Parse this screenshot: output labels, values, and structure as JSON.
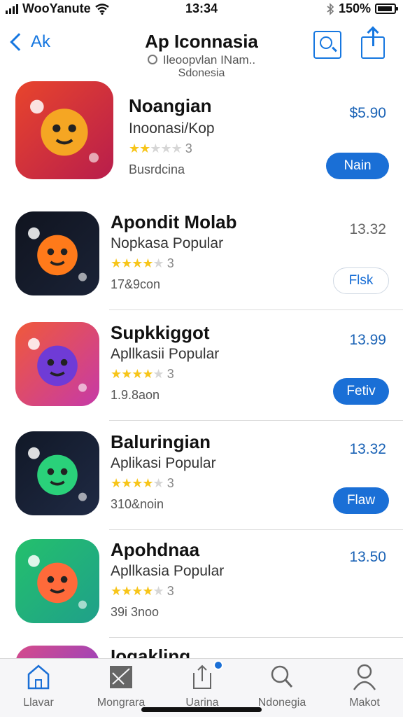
{
  "status_bar": {
    "carrier": "WooYanute",
    "time": "13:34",
    "battery": "150%"
  },
  "header": {
    "back_label": "Ak",
    "title": "Ap Iconnasia",
    "subtitle": "Ileoopvlan INam..",
    "subtitle2": "Sdonesia",
    "search_icon": "search-icon",
    "share_icon": "share-icon"
  },
  "apps": [
    {
      "name": "Noangian",
      "category": "Inoonasi/Kop",
      "rating_count": "3",
      "stars": 2,
      "downloads": "Busrdcina",
      "price": "$5.90",
      "button_label": "Nain",
      "button_style": "filled",
      "colors": [
        "#e8452c",
        "#b81d4c",
        "#f5a623"
      ]
    },
    {
      "name": "Apondit Molab",
      "category": "Nopkasa Popular",
      "rating_count": "3",
      "stars": 4,
      "downloads": "17&9con",
      "price": "13.32",
      "button_label": "Flsk",
      "button_style": "outline",
      "colors": [
        "#10141f",
        "#1a2236",
        "#ff7a1a"
      ]
    },
    {
      "name": "Supkkiggot",
      "category": "Apllkasii Popular",
      "rating_count": "3",
      "stars": 4,
      "downloads": "1.9.8aon",
      "price": "13.99",
      "button_label": "Fetiv",
      "button_style": "filled",
      "colors": [
        "#f0593a",
        "#c63aa8",
        "#6f3bd6"
      ]
    },
    {
      "name": "Baluringian",
      "category": "Aplikasi Popular",
      "rating_count": "3",
      "stars": 4,
      "downloads": "310&noin",
      "price": "13.32",
      "button_label": "Flaw",
      "button_style": "filled",
      "colors": [
        "#111827",
        "#1f2a44",
        "#2ad17a"
      ]
    },
    {
      "name": "Apohdnaa",
      "category": "Apllkasia Popular",
      "rating_count": "3",
      "stars": 4,
      "downloads": "39i 3noo",
      "price": "13.50",
      "button_label": "",
      "button_style": "none",
      "colors": [
        "#24c06c",
        "#1fa08a",
        "#ff6a3a"
      ]
    },
    {
      "name": "Iogakling",
      "category": "",
      "rating_count": "",
      "stars": 0,
      "downloads": "",
      "price": "",
      "button_label": "",
      "button_style": "none",
      "colors": [
        "#d64b8a",
        "#7b3fd6",
        "#2a7be0"
      ]
    }
  ],
  "tabs": [
    {
      "label": "Llavar",
      "icon": "home-icon",
      "active": true
    },
    {
      "label": "Mongrara",
      "icon": "games-icon",
      "active": false
    },
    {
      "label": "Uarina",
      "icon": "apps-icon",
      "active": false,
      "badge": true
    },
    {
      "label": "Ndonegia",
      "icon": "search-icon",
      "active": false
    },
    {
      "label": "Makot",
      "icon": "profile-icon",
      "active": false
    }
  ],
  "accent_color": "#1a6fd6"
}
